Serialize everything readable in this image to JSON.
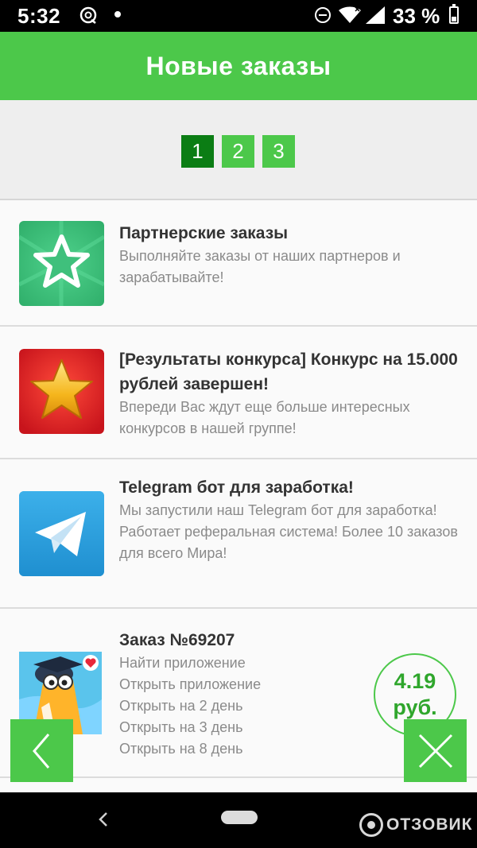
{
  "status_bar": {
    "time": "5:32",
    "battery_percent": "33 %",
    "icons": [
      "notification-app-icon",
      "dot-icon",
      "do-not-disturb-icon",
      "wifi-icon",
      "signal-icon",
      "battery-icon"
    ]
  },
  "header": {
    "title": "Новые заказы"
  },
  "pager": {
    "pages": [
      "1",
      "2",
      "3"
    ],
    "active_page": "1",
    "active_color": "#0b7d14",
    "color": "#4cc84a"
  },
  "items": [
    {
      "title": "Партнерские заказы",
      "description": "Выполняйте заказы от наших партнеров и зарабатывайте!",
      "icon": "green-star-icon"
    },
    {
      "title": "[Результаты конкурса] Конкурс на 15.000 рублей завершен!",
      "description": "Впереди Вас ждут еще больше интересных конкурсов в нашей группе!",
      "icon": "gold-star-icon"
    },
    {
      "title": "Telegram бот для заработка!",
      "description": "Мы запустили наш Telegram бот для заработка! Работает реферальная система! Более 10 заказов для всего Мира!",
      "icon": "telegram-icon"
    },
    {
      "title": "Заказ №69207",
      "tasks": [
        "Найти приложение",
        "Открыть приложение",
        "Открыть на 2 день",
        "Открыть на 3 день",
        "Открыть на 8 день"
      ],
      "price_value": "4.19",
      "price_unit": "руб.",
      "icon": "app-bird-icon"
    }
  ],
  "controls": {
    "back_icon": "chevron-left-icon",
    "close_icon": "close-icon"
  },
  "watermark": {
    "text": "ОТЗОВИК"
  },
  "colors": {
    "accent": "#4cc84a",
    "accent_dark": "#0b7d14",
    "price": "#2fa62c"
  }
}
